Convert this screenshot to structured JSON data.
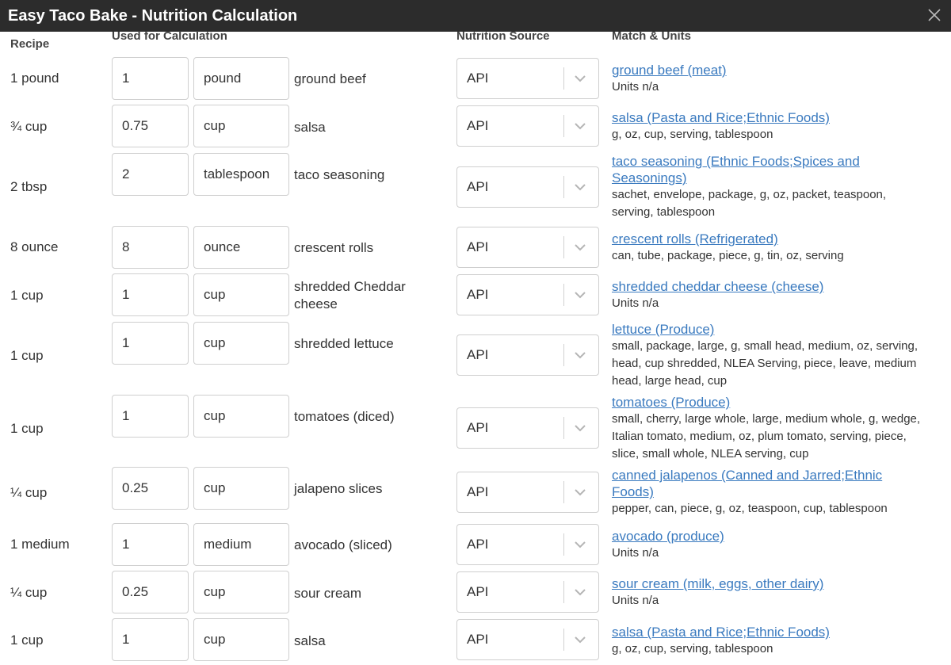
{
  "dialog": {
    "title": "Easy Taco Bake - Nutrition Calculation",
    "close_icon": "close-icon"
  },
  "headers": {
    "recipe": "Recipe",
    "used": "Used for Calculation",
    "source": "Nutrition Source",
    "match": "Match & Units"
  },
  "rows": [
    {
      "recipe": "1 pound",
      "amount": "1",
      "unit": "pound",
      "ingredient": "ground beef",
      "source": "API",
      "match": "ground beef (meat)",
      "units": "Units n/a"
    },
    {
      "recipe": "¾ cup",
      "amount": "0.75",
      "unit": "cup",
      "ingredient": "salsa",
      "source": "API",
      "match": "salsa (Pasta and Rice;Ethnic Foods)",
      "units": "g, oz, cup, serving, tablespoon"
    },
    {
      "recipe": "2 tbsp",
      "amount": "2",
      "unit": "tablespoon",
      "ingredient": "taco seasoning",
      "source": "API",
      "match": "taco seasoning (Ethnic Foods;Spices and Seasonings)",
      "units": "sachet, envelope, package, g, oz, packet, teaspoon, serving, tablespoon"
    },
    {
      "recipe": "8 ounce",
      "amount": "8",
      "unit": "ounce",
      "ingredient": "crescent rolls",
      "source": "API",
      "match": "crescent rolls (Refrigerated)",
      "units": "can, tube, package, piece, g, tin, oz, serving"
    },
    {
      "recipe": "1 cup",
      "amount": "1",
      "unit": "cup",
      "ingredient": "shredded Cheddar cheese",
      "source": "API",
      "match": "shredded cheddar cheese (cheese)",
      "units": "Units n/a"
    },
    {
      "recipe": "1 cup",
      "amount": "1",
      "unit": "cup",
      "ingredient": "shredded lettuce",
      "source": "API",
      "match": "lettuce (Produce)",
      "units": "small, package, large, g, small head, medium, oz, serving, head, cup shredded, NLEA Serving, piece, leave, medium head, large head, cup"
    },
    {
      "recipe": "1 cup",
      "amount": "1",
      "unit": "cup",
      "ingredient": "tomatoes (diced)",
      "source": "API",
      "match": "tomatoes (Produce)",
      "units": "small, cherry, large whole, large, medium whole, g, wedge, Italian tomato, medium, oz, plum tomato, serving, piece, slice, small whole, NLEA serving, cup"
    },
    {
      "recipe": "¼ cup",
      "amount": "0.25",
      "unit": "cup",
      "ingredient": "jalapeno slices",
      "source": "API",
      "match": "canned jalapenos (Canned and Jarred;Ethnic Foods)",
      "units": "pepper, can, piece, g, oz, teaspoon, cup, tablespoon"
    },
    {
      "recipe": "1 medium",
      "amount": "1",
      "unit": "medium",
      "ingredient": "avocado (sliced)",
      "source": "API",
      "match": "avocado (produce)",
      "units": "Units n/a"
    },
    {
      "recipe": "¼ cup",
      "amount": "0.25",
      "unit": "cup",
      "ingredient": "sour cream",
      "source": "API",
      "match": "sour cream (milk, eggs, other dairy)",
      "units": "Units n/a"
    },
    {
      "recipe": "1 cup",
      "amount": "1",
      "unit": "cup",
      "ingredient": "salsa",
      "source": "API",
      "match": "salsa (Pasta and Rice;Ethnic Foods)",
      "units": "g, oz, cup, serving, tablespoon"
    }
  ]
}
